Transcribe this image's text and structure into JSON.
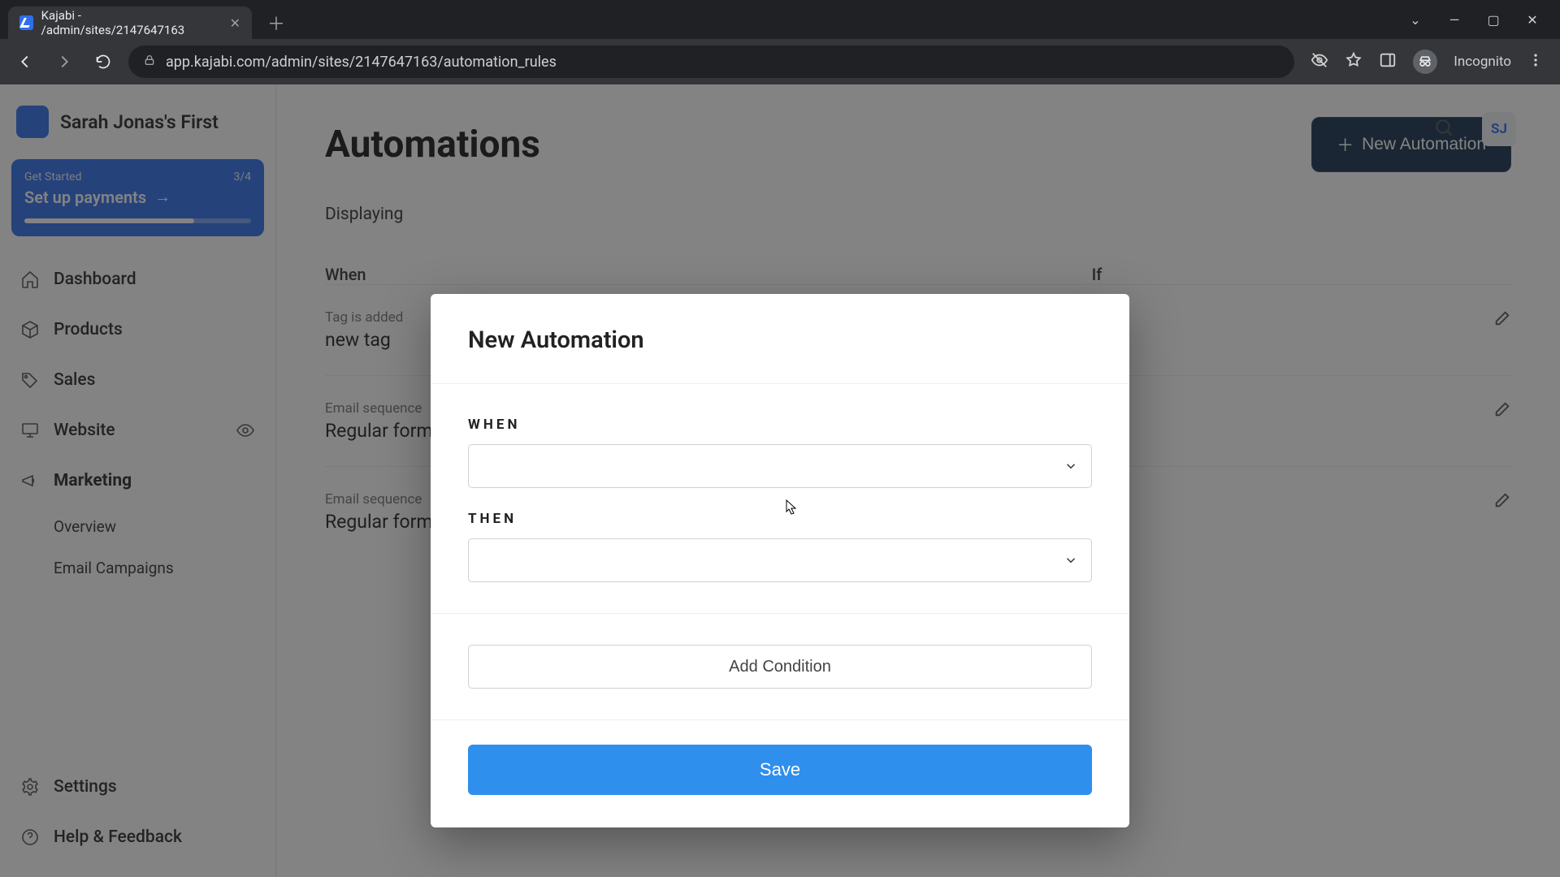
{
  "browser": {
    "tab_title": "Kajabi - /admin/sites/2147647163",
    "url": "app.kajabi.com/admin/sites/2147647163/automation_rules",
    "incognito_label": "Incognito"
  },
  "header": {
    "site_name": "Sarah Jonas's First",
    "avatar_initials": "SJ"
  },
  "get_started": {
    "kicker": "Get Started",
    "progress_label": "3/4",
    "title": "Set up payments"
  },
  "sidebar": {
    "items": [
      {
        "label": "Dashboard"
      },
      {
        "label": "Products"
      },
      {
        "label": "Sales"
      },
      {
        "label": "Website"
      },
      {
        "label": "Marketing"
      }
    ],
    "marketing_sub": [
      {
        "label": "Overview"
      },
      {
        "label": "Email Campaigns"
      }
    ],
    "settings_label": "Settings",
    "help_label": "Help & Feedback"
  },
  "main": {
    "page_title": "Automations",
    "new_button": "New Automation",
    "displaying": "Displaying",
    "columns": {
      "when": "When",
      "if": "If"
    },
    "rows": [
      {
        "kicker": "Tag is added",
        "title": "new tag",
        "if_value": "—"
      },
      {
        "kicker": "Email sequence",
        "title": "Regular form",
        "if_value": "—"
      },
      {
        "kicker": "Email sequence",
        "title": "Regular form",
        "if_value": "—"
      }
    ]
  },
  "modal": {
    "title": "New Automation",
    "when_label": "WHEN",
    "then_label": "THEN",
    "add_condition": "Add Condition",
    "save": "Save"
  }
}
